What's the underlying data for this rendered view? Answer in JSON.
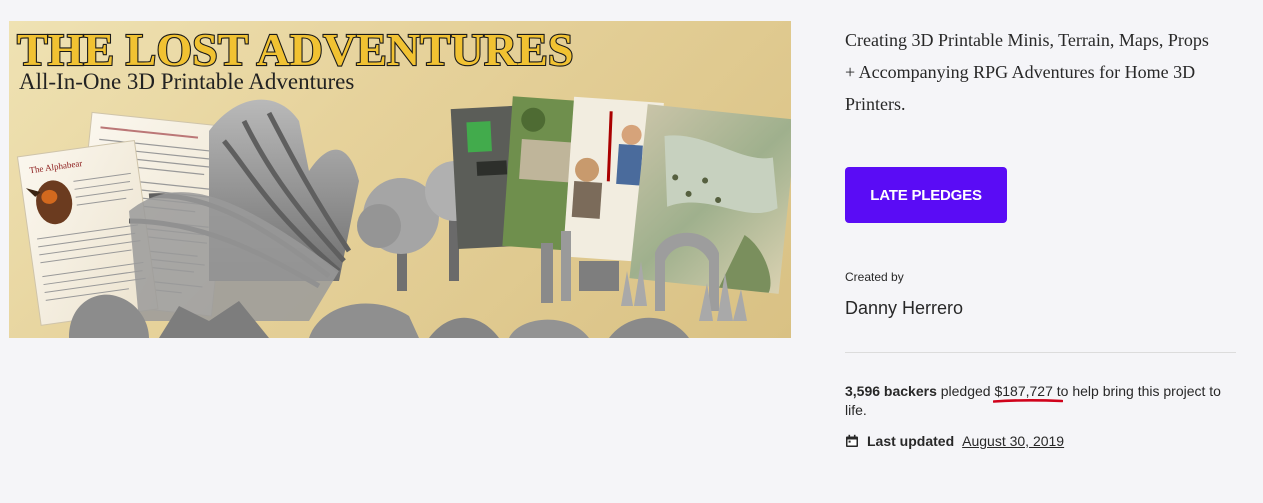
{
  "hero": {
    "title": "THE LOST ADVENTURES",
    "subtitle": "All-In-One 3D Printable Adventures",
    "page_heading": "The Alphabear"
  },
  "project": {
    "blurb": "Creating 3D Printable Minis, Terrain, Maps, Props + Accompanying RPG Adventures for Home 3D Printers.",
    "cta_label": "LATE PLEDGES",
    "created_by_label": "Created by",
    "creator_name": "Danny Herrero"
  },
  "stats": {
    "backers": "3,596 backers",
    "pledged_word": "pledged",
    "amount": "$187,727",
    "rest": "to help bring this project to life."
  },
  "updated": {
    "label": "Last updated",
    "date": "August 30, 2019"
  },
  "colors": {
    "accent": "#5a0cf5",
    "annotation": "#d0021b",
    "title_gold": "#f1c232"
  },
  "icons": {
    "calendar": "calendar-icon"
  }
}
